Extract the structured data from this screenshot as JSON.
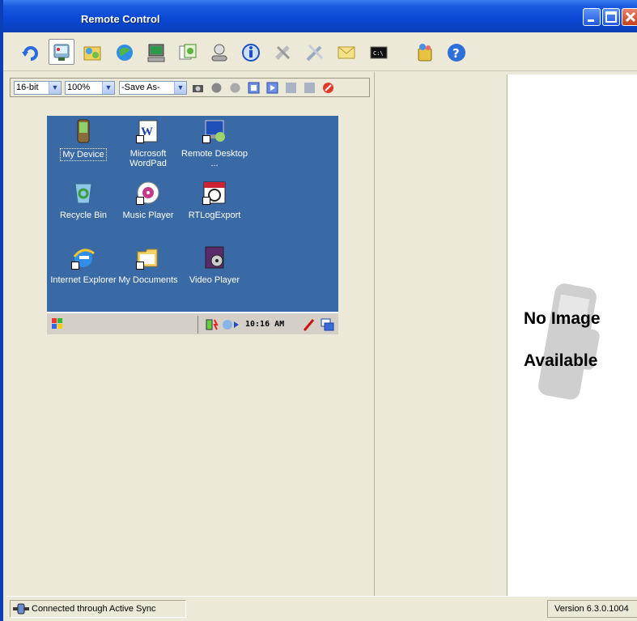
{
  "window": {
    "title": "Remote Control",
    "controls": [
      "minimize",
      "maximize",
      "close"
    ]
  },
  "toolbar": {
    "icons": [
      "refresh-icon",
      "remote-control-icon",
      "file-explorer-icon",
      "internet-icon",
      "computer-icon",
      "copy-icon",
      "user-icon",
      "info-icon",
      "tools-icon",
      "settings-icon",
      "mail-icon",
      "terminal-icon",
      "security-icon",
      "help-icon"
    ]
  },
  "remote_toolbar": {
    "color_depth": "16-bit",
    "zoom": "100%",
    "save_as": "-Save As-"
  },
  "device": {
    "icons": [
      {
        "label": "My Device",
        "icon": "pda-icon"
      },
      {
        "label": "Microsoft WordPad",
        "icon": "wordpad-icon"
      },
      {
        "label": "Remote Desktop ...",
        "icon": "remote-desktop-icon"
      },
      {
        "label": "Recycle Bin",
        "icon": "recycle-bin-icon"
      },
      {
        "label": "Music Player",
        "icon": "music-player-icon"
      },
      {
        "label": "RTLogExport",
        "icon": "calendar-icon"
      },
      {
        "label": "Internet Explorer",
        "icon": "internet-explorer-icon"
      },
      {
        "label": "My Documents",
        "icon": "folder-icon"
      },
      {
        "label": "Video Player",
        "icon": "video-player-icon"
      }
    ],
    "clock": "10:16 AM"
  },
  "preview": {
    "line1": "No Image",
    "line2": "Available"
  },
  "status": {
    "connection": "Connected through Active Sync",
    "version": "Version 6.3.0.1004"
  },
  "colors": {
    "title_bar": "#0a47d4",
    "device_desktop": "#3a6aa6",
    "window_face": "#ece9d8"
  }
}
